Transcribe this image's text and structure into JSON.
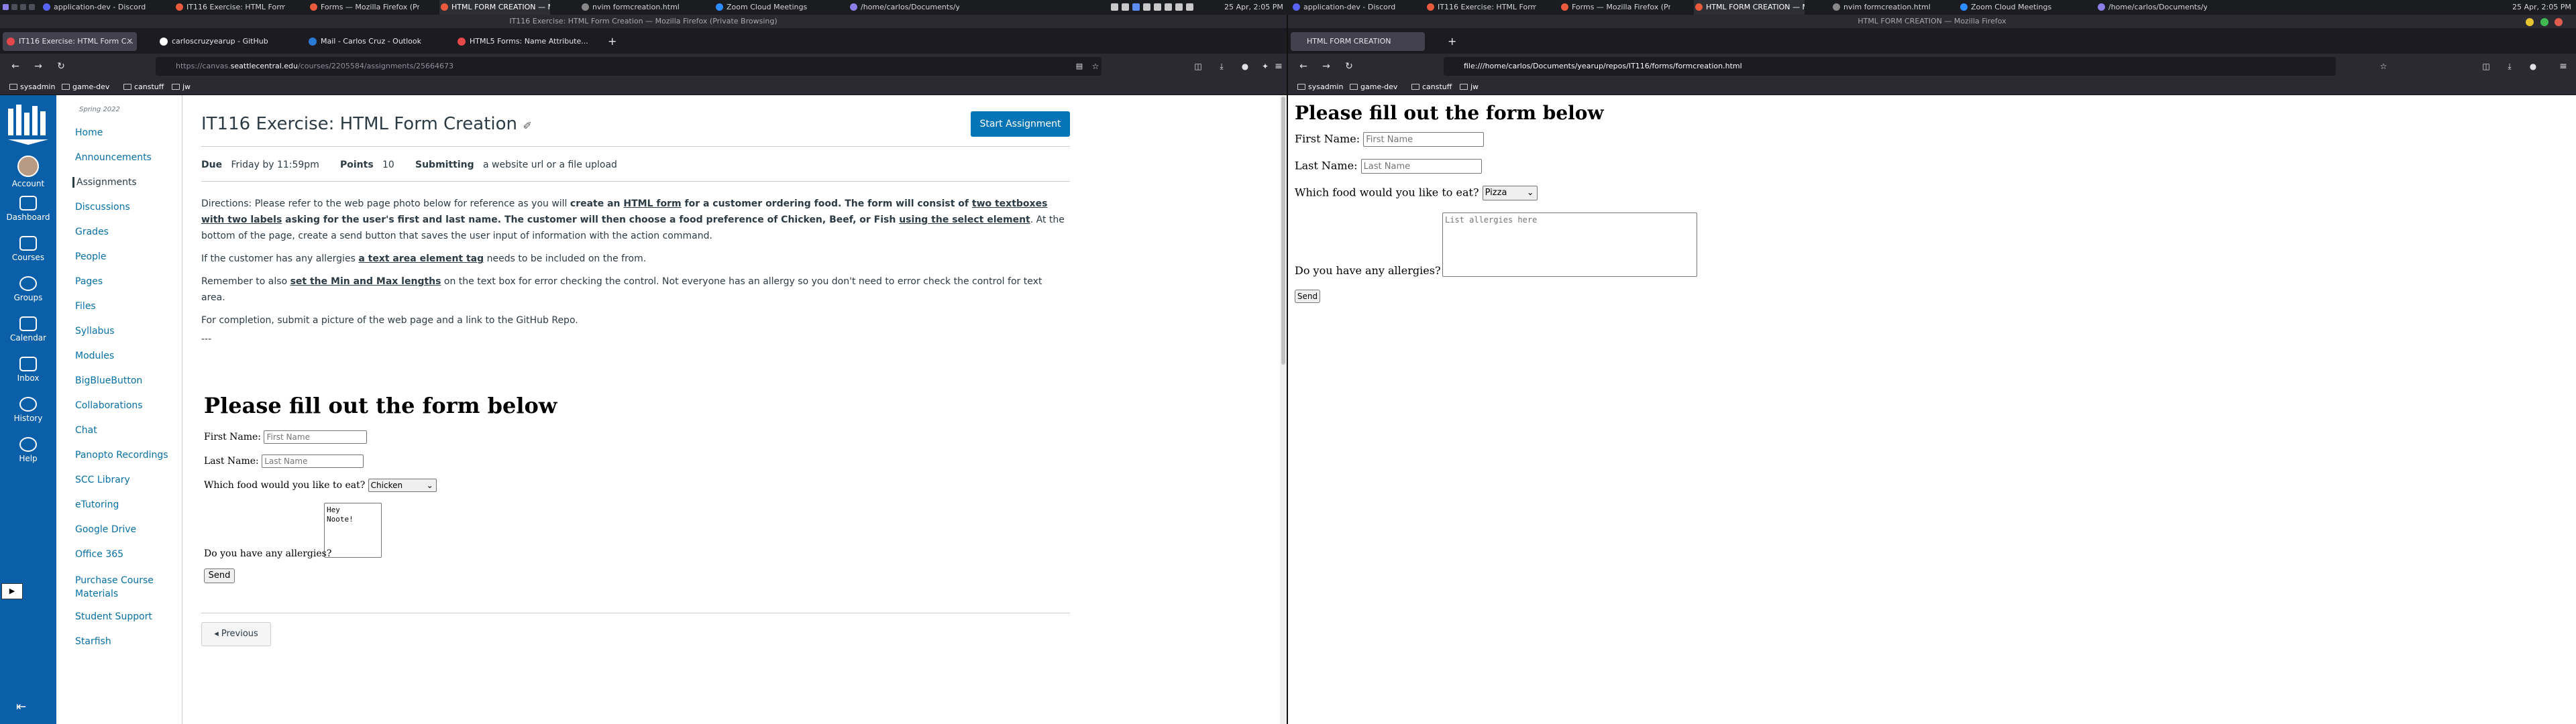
{
  "taskbar": {
    "items": [
      {
        "label": "application-dev - Discord",
        "active": false
      },
      {
        "label": "IT116 Exercise: HTML Form C...",
        "active": false
      },
      {
        "label": "Forms — Mozilla Firefox (Priva...",
        "active": false
      },
      {
        "label": "HTML FORM CREATION — Mo...",
        "active": true
      },
      {
        "label": "nvim formcreation.html",
        "active": false
      },
      {
        "label": "Zoom Cloud Meetings",
        "active": false
      },
      {
        "label": "/home/carlos/Documents/ye...",
        "active": false
      }
    ],
    "clock": "25 Apr, 2:05 PM",
    "right_items": [
      {
        "label": "application-dev - Discord",
        "active": false
      },
      {
        "label": "IT116 Exercise: HTML Form C...",
        "active": false
      },
      {
        "label": "Forms — Mozilla Firefox (Priva...",
        "active": false
      },
      {
        "label": "HTML FORM CREATION — Mo...",
        "active": true
      },
      {
        "label": "nvim formcreation.html",
        "active": false
      },
      {
        "label": "Zoom Cloud Meetings",
        "active": false
      },
      {
        "label": "/home/carlos/Documents/ye...",
        "active": false
      }
    ]
  },
  "left_window": {
    "title": "IT116 Exercise: HTML Form Creation — Mozilla Firefox (Private Browsing)",
    "tabs": [
      {
        "label": "IT116 Exercise: HTML Form C...",
        "selected": true,
        "color": "#e4484a"
      },
      {
        "label": "carloscruzyearup - GitHub",
        "selected": false,
        "color": "#ffffff"
      },
      {
        "label": "Mail - Carlos Cruz - Outlook",
        "selected": false,
        "color": "#2a7ad8"
      },
      {
        "label": "HTML5 Forms: Name Attribute...",
        "selected": false,
        "color": "#e4484a"
      }
    ],
    "url_prefix": "https://canvas.",
    "url_domain": "seattlecentral.edu",
    "url_path": "/courses/2205584/assignments/25664673",
    "bookmarks": [
      "sysadmin",
      "game-dev",
      "canstuff",
      "jw"
    ]
  },
  "canvas": {
    "global_nav": [
      "Account",
      "Dashboard",
      "Courses",
      "Groups",
      "Calendar",
      "Inbox",
      "History",
      "Help"
    ],
    "term": "Spring 2022",
    "course_menu": [
      "Home",
      "Announcements",
      "Assignments",
      "Discussions",
      "Grades",
      "People",
      "Pages",
      "Files",
      "Syllabus",
      "Modules",
      "BigBlueButton",
      "Collaborations",
      "Chat",
      "Panopto Recordings",
      "SCC Library",
      "eTutoring",
      "Google Drive",
      "Office 365",
      "Purchase Course Materials",
      "Student Support",
      "Starfish"
    ],
    "active_menu": "Assignments",
    "assignment_title": "IT116 Exercise: HTML Form Creation",
    "start_button": "Start Assignment",
    "meta": {
      "due_label": "Due",
      "due_value": "Friday by 11:59pm",
      "points_label": "Points",
      "points_value": "10",
      "submitting_label": "Submitting",
      "submitting_value": "a website url or a file upload"
    },
    "directions": {
      "p1_a": "Directions: Please refer to the web page photo below for reference as you will ",
      "p1_b": "create an ",
      "p1_c": "HTML form",
      "p1_d": " for a customer ordering food. The form will consist of ",
      "p1_e": "two textboxes with two labels",
      "p1_f": " asking for the user's first and last name. The customer will then choose a food preference of Chicken, Beef, or Fish ",
      "p1_g": "using the select element",
      "p1_h": ". At the bottom of the page, create a send button that saves the user input of information with the action command.",
      "p2_a": "If the customer has any allergies ",
      "p2_b": "a text area element tag",
      "p2_c": " needs to be included on the from.",
      "p3_a": "Remember to also ",
      "p3_b": "set the Min and Max lengths",
      "p3_c": " on the text box for error checking the control. Not everyone has an allergy so you don't need to error check the control for text area.",
      "p4": "For completion, submit a picture of the web page and a link to the GitHub Repo.",
      "sep": "---"
    },
    "sample_form": {
      "heading": "Please fill out the form below",
      "first_label": "First Name:",
      "first_placeholder": "First Name",
      "last_label": "Last Name:",
      "last_placeholder": "Last Name",
      "food_label": "Which food would you like to eat?",
      "food_selected": "Chicken",
      "allergy_label": "Do you have any allergies?",
      "allergy_text": "Hey\nNoote!",
      "send": "Send"
    },
    "previous": "◂ Previous"
  },
  "right_window": {
    "title": "HTML FORM CREATION — Mozilla Firefox",
    "tab": "HTML FORM CREATION",
    "url": "file:///home/carlos/Documents/yearup/repos/IT116/forms/formcreation.html",
    "bookmarks": [
      "sysadmin",
      "game-dev",
      "canstuff",
      "jw"
    ],
    "form": {
      "heading": "Please fill out the form below",
      "first_label": "First Name:",
      "first_placeholder": "First Name",
      "last_label": "Last Name:",
      "last_placeholder": "Last Name",
      "food_label": "Which food would you like to eat?",
      "food_selected": "Pizza",
      "allergy_label": "Do you have any allergies?",
      "allergy_placeholder": "List allergies here",
      "send": "Send"
    }
  },
  "colors": {
    "canvas_nav": "#0b5fa8",
    "start_button": "#0374b5",
    "link": "#0770a3"
  }
}
